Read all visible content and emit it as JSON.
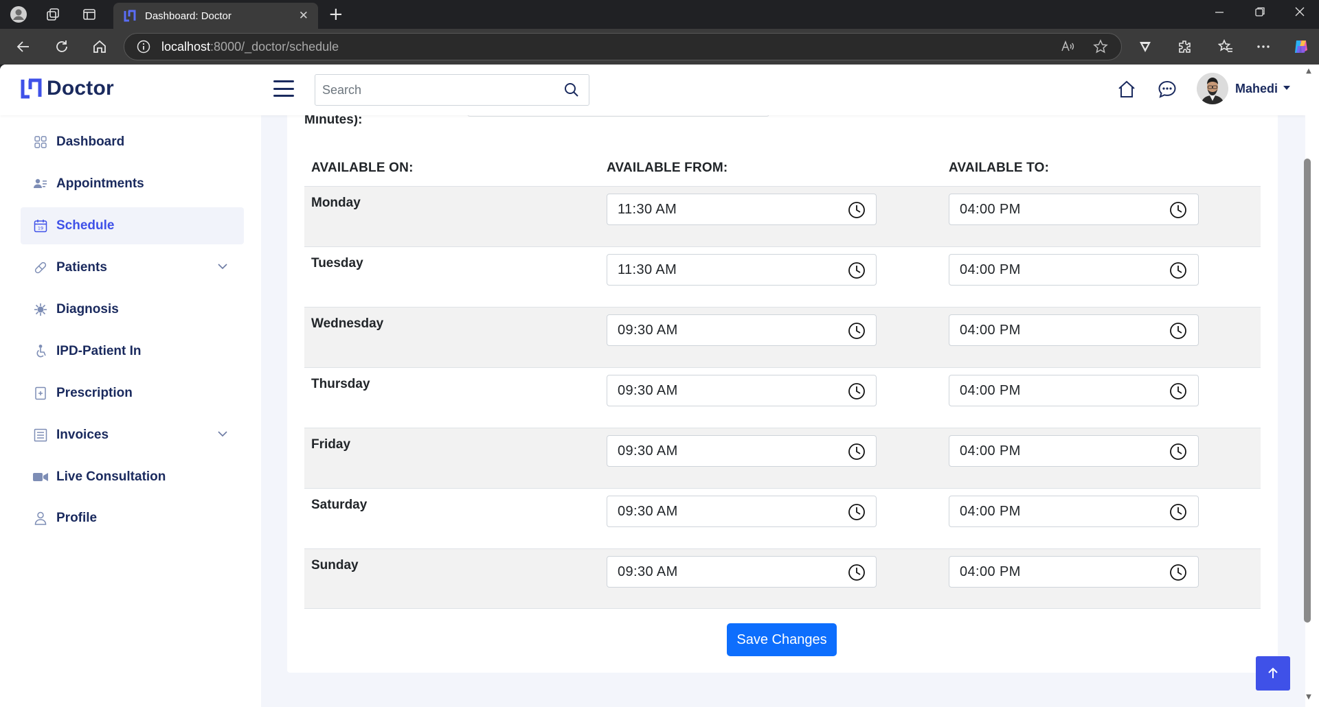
{
  "browser": {
    "tab_title": "Dashboard: Doctor",
    "tab_close": "✕",
    "new_tab": "+",
    "url_host": "localhost",
    "url_path": ":8000/_doctor/schedule"
  },
  "app": {
    "brand": "Doctor",
    "search": {
      "placeholder": "Search"
    },
    "user": {
      "name": "Mahedi"
    }
  },
  "sidebar": {
    "items": [
      {
        "label": "Dashboard",
        "icon": "grid-icon"
      },
      {
        "label": "Appointments",
        "icon": "users-icon"
      },
      {
        "label": "Schedule",
        "icon": "calendar-icon",
        "active": true
      },
      {
        "label": "Patients",
        "icon": "pill-icon",
        "expandable": true
      },
      {
        "label": "Diagnosis",
        "icon": "virus-icon"
      },
      {
        "label": "IPD-Patient In",
        "icon": "wheelchair-icon"
      },
      {
        "label": "Prescription",
        "icon": "prescription-icon"
      },
      {
        "label": "Invoices",
        "icon": "invoice-icon",
        "expandable": true
      },
      {
        "label": "Live Consultation",
        "icon": "video-icon"
      },
      {
        "label": "Profile",
        "icon": "user-icon"
      }
    ]
  },
  "schedule": {
    "cut_label": "Minutes):",
    "headers": {
      "available_on": "AVAILABLE ON:",
      "available_from": "AVAILABLE FROM:",
      "available_to": "AVAILABLE TO:"
    },
    "rows": [
      {
        "day": "Monday",
        "from": "11:30  AM",
        "to": "04:00  PM"
      },
      {
        "day": "Tuesday",
        "from": "11:30  AM",
        "to": "04:00  PM"
      },
      {
        "day": "Wednesday",
        "from": "09:30  AM",
        "to": "04:00  PM"
      },
      {
        "day": "Thursday",
        "from": "09:30  AM",
        "to": "04:00  PM"
      },
      {
        "day": "Friday",
        "from": "09:30  AM",
        "to": "04:00  PM"
      },
      {
        "day": "Saturday",
        "from": "09:30  AM",
        "to": "04:00  PM"
      },
      {
        "day": "Sunday",
        "from": "09:30  AM",
        "to": "04:00  PM"
      }
    ],
    "save_label": "Save Changes"
  },
  "colors": {
    "brand": "#1a2a5e",
    "accent": "#3f51e8",
    "primary_button": "#0d6efd"
  }
}
